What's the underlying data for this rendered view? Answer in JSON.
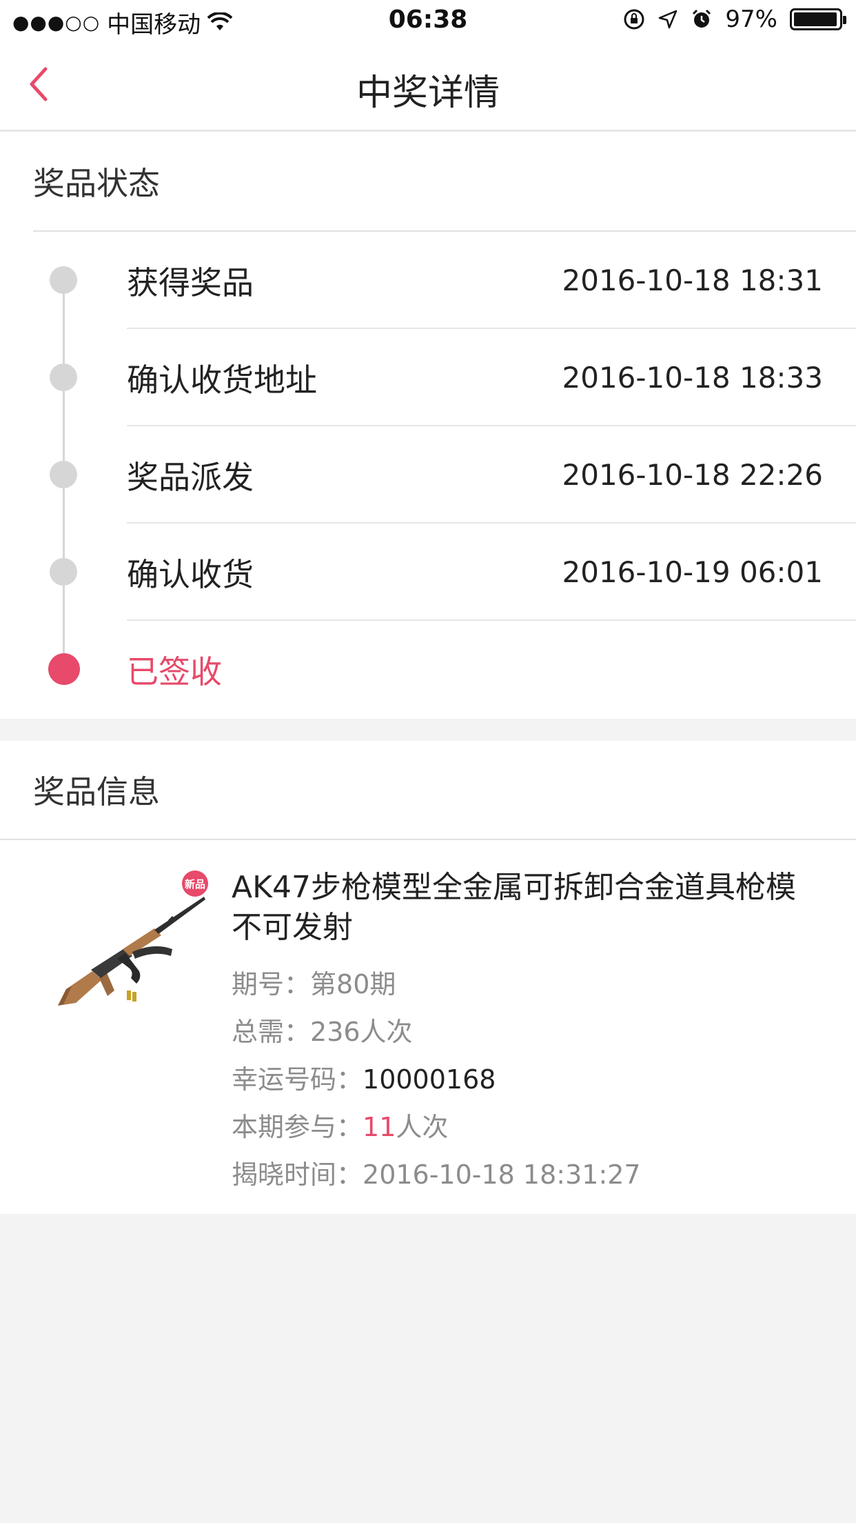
{
  "status_bar": {
    "signal": "●●●○○",
    "carrier": "中国移动",
    "time": "06:38",
    "battery": "97%",
    "battery_level": 0.97
  },
  "nav": {
    "title": "中奖详情"
  },
  "status_section": {
    "title": "奖品状态",
    "steps": [
      {
        "label": "获得奖品",
        "time": "2016-10-18 18:31"
      },
      {
        "label": "确认收货地址",
        "time": "2016-10-18 18:33"
      },
      {
        "label": "奖品派发",
        "time": "2016-10-18 22:26"
      },
      {
        "label": "确认收货",
        "time": "2016-10-19 06:01"
      },
      {
        "label": "已签收",
        "time": ""
      }
    ]
  },
  "info_section": {
    "title": "奖品信息",
    "badge": "新品",
    "product_title": "AK47步枪模型全金属可拆卸合金道具枪模不可发射",
    "period_label": "期号：",
    "period_value": "第80期",
    "total_label": "总需：",
    "total_value": "236人次",
    "lucky_label": "幸运号码：",
    "lucky_value": "10000168",
    "join_label": "本期参与：",
    "join_count": "11",
    "join_unit": "人次",
    "reveal_label": "揭晓时间：",
    "reveal_value": "2016-10-18 18:31:27"
  },
  "colors": {
    "accent": "#e74a6a",
    "background": "#f3f3f3"
  }
}
